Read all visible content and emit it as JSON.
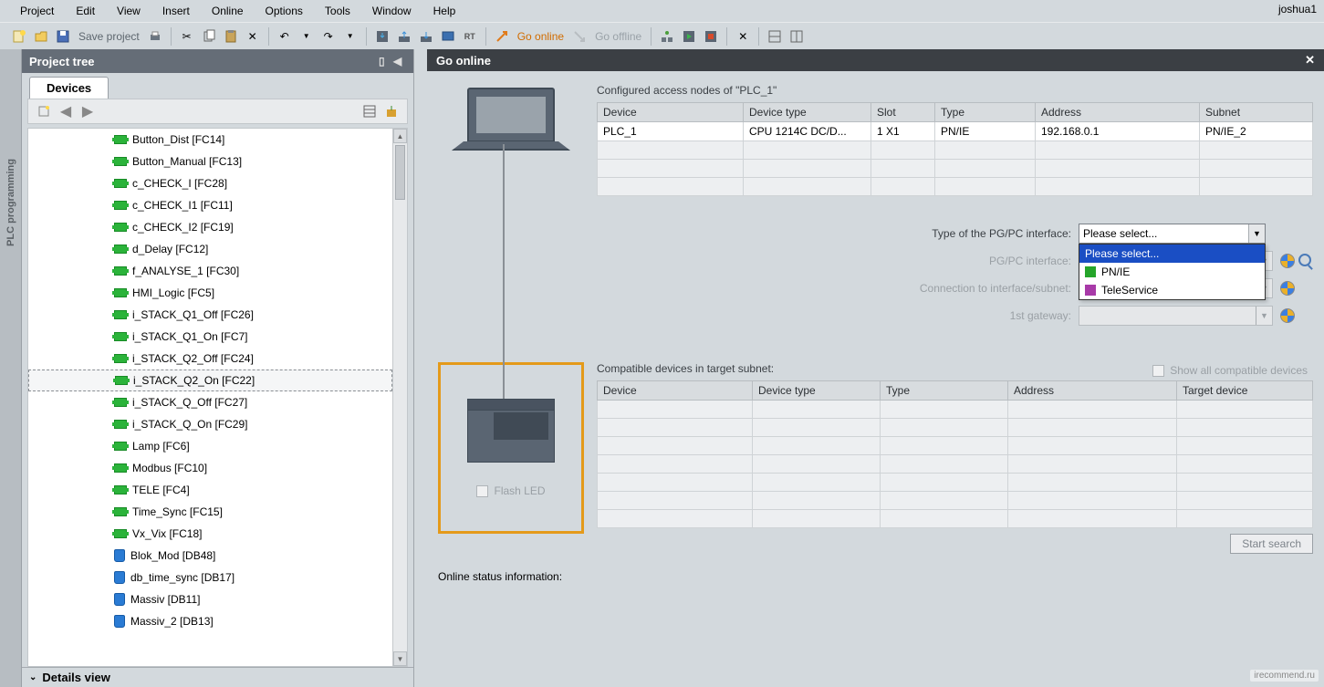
{
  "user": "joshua1",
  "menubar": [
    "Project",
    "Edit",
    "View",
    "Insert",
    "Online",
    "Options",
    "Tools",
    "Window",
    "Help"
  ],
  "toolbar": {
    "save_label": "Save project",
    "go_online": "Go online",
    "go_offline": "Go offline"
  },
  "project_tree": {
    "title": "Project tree",
    "tab": "Devices",
    "items": [
      {
        "type": "fc",
        "label": "Button_Dist [FC14]"
      },
      {
        "type": "fc",
        "label": "Button_Manual [FC13]"
      },
      {
        "type": "fc",
        "label": "c_CHECK_I [FC28]"
      },
      {
        "type": "fc",
        "label": "c_CHECK_I1 [FC11]"
      },
      {
        "type": "fc",
        "label": "c_CHECK_I2 [FC19]"
      },
      {
        "type": "fc",
        "label": "d_Delay [FC12]"
      },
      {
        "type": "fc",
        "label": "f_ANALYSE_1 [FC30]"
      },
      {
        "type": "fc",
        "label": "HMI_Logic [FC5]"
      },
      {
        "type": "fc",
        "label": "i_STACK_Q1_Off [FC26]"
      },
      {
        "type": "fc",
        "label": "i_STACK_Q1_On [FC7]"
      },
      {
        "type": "fc",
        "label": "i_STACK_Q2_Off [FC24]"
      },
      {
        "type": "fc",
        "label": "i_STACK_Q2_On [FC22]",
        "selected": true
      },
      {
        "type": "fc",
        "label": "i_STACK_Q_Off [FC27]"
      },
      {
        "type": "fc",
        "label": "i_STACK_Q_On [FC29]"
      },
      {
        "type": "fc",
        "label": "Lamp [FC6]"
      },
      {
        "type": "fc",
        "label": "Modbus [FC10]"
      },
      {
        "type": "fc",
        "label": "TELE [FC4]"
      },
      {
        "type": "fc",
        "label": "Time_Sync [FC15]"
      },
      {
        "type": "fc",
        "label": "Vx_Vix [FC18]"
      },
      {
        "type": "db",
        "label": "Blok_Mod [DB48]"
      },
      {
        "type": "db",
        "label": "db_time_sync [DB17]"
      },
      {
        "type": "db",
        "label": "Massiv [DB11]"
      },
      {
        "type": "db",
        "label": "Massiv_2 [DB13]"
      }
    ],
    "details": "Details view"
  },
  "side_tab": "PLC programming",
  "dialog": {
    "title": "Go online",
    "caption": "Configured access nodes of \"PLC_1\"",
    "table1": {
      "headers": [
        "Device",
        "Device type",
        "Slot",
        "Type",
        "Address",
        "Subnet"
      ],
      "row": [
        "PLC_1",
        "CPU 1214C DC/D...",
        "1 X1",
        "PN/IE",
        "192.168.0.1",
        "PN/IE_2"
      ]
    },
    "labels": {
      "type_pgpc": "Type of the PG/PC interface:",
      "pgpc": "PG/PC interface:",
      "conn": "Connection to interface/subnet:",
      "gw": "1st gateway:"
    },
    "combo_value": "Please select...",
    "dropdown": [
      "Please select...",
      "PN/IE",
      "TeleService"
    ],
    "compat_caption": "Compatible devices in target subnet:",
    "show_all": "Show all compatible devices",
    "table2_headers": [
      "Device",
      "Device type",
      "Type",
      "Address",
      "Target device"
    ],
    "flash_led": "Flash LED",
    "start_search": "Start search",
    "status": "Online status information:"
  },
  "watermark": "irecommend.ru"
}
